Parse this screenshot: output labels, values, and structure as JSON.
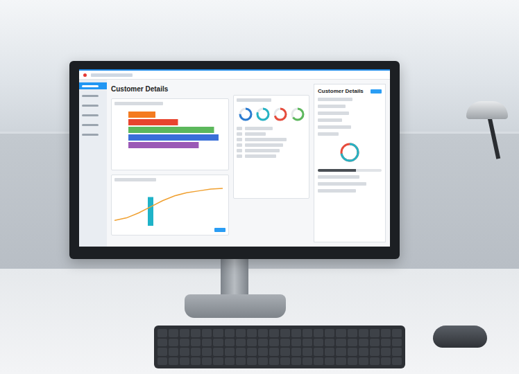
{
  "screen": {
    "title": "Customer Details"
  },
  "sidebar": {
    "items": [
      {
        "selected": true
      },
      {
        "selected": false
      },
      {
        "selected": false
      },
      {
        "selected": false
      },
      {
        "selected": false
      },
      {
        "selected": false
      }
    ]
  },
  "bar_chart": {
    "max": 100,
    "bars": [
      {
        "value": 30,
        "color": "#f47b20"
      },
      {
        "value": 55,
        "color": "#e8442e"
      },
      {
        "value": 95,
        "color": "#5cb85c"
      },
      {
        "value": 100,
        "color": "#3a6fd8"
      },
      {
        "value": 78,
        "color": "#9b59b6"
      }
    ]
  },
  "line_chart": {
    "max": 70,
    "values": [
      10,
      14,
      22,
      32,
      42,
      50,
      55,
      58,
      61,
      62
    ],
    "color": "#f0a030",
    "highlight": {
      "index": 3,
      "value": 48,
      "color": "#1fb3c8"
    }
  },
  "donuts": [
    {
      "level": 0.75,
      "color": "#2a7bd1"
    },
    {
      "level": 0.8,
      "color": "#26b3c4"
    },
    {
      "level": 0.7,
      "color": "#e74c3c"
    },
    {
      "level": 0.65,
      "color": "#5cb85c"
    }
  ],
  "right_panel": {
    "title": "Customer Details",
    "donut": {
      "level": 0.72,
      "color": "#26b3c4",
      "rest_color": "#e74c3c"
    },
    "progress": {
      "level": 0.6
    }
  }
}
